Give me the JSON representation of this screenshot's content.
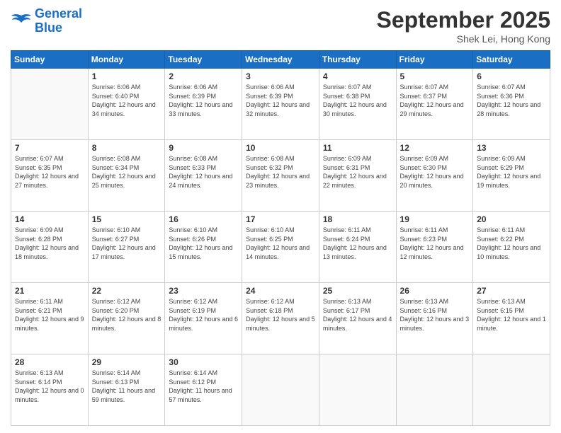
{
  "header": {
    "logo_line1": "General",
    "logo_line2": "Blue",
    "month_title": "September 2025",
    "location": "Shek Lei, Hong Kong"
  },
  "weekdays": [
    "Sunday",
    "Monday",
    "Tuesday",
    "Wednesday",
    "Thursday",
    "Friday",
    "Saturday"
  ],
  "weeks": [
    [
      {
        "day": "",
        "sunrise": "",
        "sunset": "",
        "daylight": ""
      },
      {
        "day": "1",
        "sunrise": "Sunrise: 6:06 AM",
        "sunset": "Sunset: 6:40 PM",
        "daylight": "Daylight: 12 hours and 34 minutes."
      },
      {
        "day": "2",
        "sunrise": "Sunrise: 6:06 AM",
        "sunset": "Sunset: 6:39 PM",
        "daylight": "Daylight: 12 hours and 33 minutes."
      },
      {
        "day": "3",
        "sunrise": "Sunrise: 6:06 AM",
        "sunset": "Sunset: 6:39 PM",
        "daylight": "Daylight: 12 hours and 32 minutes."
      },
      {
        "day": "4",
        "sunrise": "Sunrise: 6:07 AM",
        "sunset": "Sunset: 6:38 PM",
        "daylight": "Daylight: 12 hours and 30 minutes."
      },
      {
        "day": "5",
        "sunrise": "Sunrise: 6:07 AM",
        "sunset": "Sunset: 6:37 PM",
        "daylight": "Daylight: 12 hours and 29 minutes."
      },
      {
        "day": "6",
        "sunrise": "Sunrise: 6:07 AM",
        "sunset": "Sunset: 6:36 PM",
        "daylight": "Daylight: 12 hours and 28 minutes."
      }
    ],
    [
      {
        "day": "7",
        "sunrise": "Sunrise: 6:07 AM",
        "sunset": "Sunset: 6:35 PM",
        "daylight": "Daylight: 12 hours and 27 minutes."
      },
      {
        "day": "8",
        "sunrise": "Sunrise: 6:08 AM",
        "sunset": "Sunset: 6:34 PM",
        "daylight": "Daylight: 12 hours and 25 minutes."
      },
      {
        "day": "9",
        "sunrise": "Sunrise: 6:08 AM",
        "sunset": "Sunset: 6:33 PM",
        "daylight": "Daylight: 12 hours and 24 minutes."
      },
      {
        "day": "10",
        "sunrise": "Sunrise: 6:08 AM",
        "sunset": "Sunset: 6:32 PM",
        "daylight": "Daylight: 12 hours and 23 minutes."
      },
      {
        "day": "11",
        "sunrise": "Sunrise: 6:09 AM",
        "sunset": "Sunset: 6:31 PM",
        "daylight": "Daylight: 12 hours and 22 minutes."
      },
      {
        "day": "12",
        "sunrise": "Sunrise: 6:09 AM",
        "sunset": "Sunset: 6:30 PM",
        "daylight": "Daylight: 12 hours and 20 minutes."
      },
      {
        "day": "13",
        "sunrise": "Sunrise: 6:09 AM",
        "sunset": "Sunset: 6:29 PM",
        "daylight": "Daylight: 12 hours and 19 minutes."
      }
    ],
    [
      {
        "day": "14",
        "sunrise": "Sunrise: 6:09 AM",
        "sunset": "Sunset: 6:28 PM",
        "daylight": "Daylight: 12 hours and 18 minutes."
      },
      {
        "day": "15",
        "sunrise": "Sunrise: 6:10 AM",
        "sunset": "Sunset: 6:27 PM",
        "daylight": "Daylight: 12 hours and 17 minutes."
      },
      {
        "day": "16",
        "sunrise": "Sunrise: 6:10 AM",
        "sunset": "Sunset: 6:26 PM",
        "daylight": "Daylight: 12 hours and 15 minutes."
      },
      {
        "day": "17",
        "sunrise": "Sunrise: 6:10 AM",
        "sunset": "Sunset: 6:25 PM",
        "daylight": "Daylight: 12 hours and 14 minutes."
      },
      {
        "day": "18",
        "sunrise": "Sunrise: 6:11 AM",
        "sunset": "Sunset: 6:24 PM",
        "daylight": "Daylight: 12 hours and 13 minutes."
      },
      {
        "day": "19",
        "sunrise": "Sunrise: 6:11 AM",
        "sunset": "Sunset: 6:23 PM",
        "daylight": "Daylight: 12 hours and 12 minutes."
      },
      {
        "day": "20",
        "sunrise": "Sunrise: 6:11 AM",
        "sunset": "Sunset: 6:22 PM",
        "daylight": "Daylight: 12 hours and 10 minutes."
      }
    ],
    [
      {
        "day": "21",
        "sunrise": "Sunrise: 6:11 AM",
        "sunset": "Sunset: 6:21 PM",
        "daylight": "Daylight: 12 hours and 9 minutes."
      },
      {
        "day": "22",
        "sunrise": "Sunrise: 6:12 AM",
        "sunset": "Sunset: 6:20 PM",
        "daylight": "Daylight: 12 hours and 8 minutes."
      },
      {
        "day": "23",
        "sunrise": "Sunrise: 6:12 AM",
        "sunset": "Sunset: 6:19 PM",
        "daylight": "Daylight: 12 hours and 6 minutes."
      },
      {
        "day": "24",
        "sunrise": "Sunrise: 6:12 AM",
        "sunset": "Sunset: 6:18 PM",
        "daylight": "Daylight: 12 hours and 5 minutes."
      },
      {
        "day": "25",
        "sunrise": "Sunrise: 6:13 AM",
        "sunset": "Sunset: 6:17 PM",
        "daylight": "Daylight: 12 hours and 4 minutes."
      },
      {
        "day": "26",
        "sunrise": "Sunrise: 6:13 AM",
        "sunset": "Sunset: 6:16 PM",
        "daylight": "Daylight: 12 hours and 3 minutes."
      },
      {
        "day": "27",
        "sunrise": "Sunrise: 6:13 AM",
        "sunset": "Sunset: 6:15 PM",
        "daylight": "Daylight: 12 hours and 1 minute."
      }
    ],
    [
      {
        "day": "28",
        "sunrise": "Sunrise: 6:13 AM",
        "sunset": "Sunset: 6:14 PM",
        "daylight": "Daylight: 12 hours and 0 minutes."
      },
      {
        "day": "29",
        "sunrise": "Sunrise: 6:14 AM",
        "sunset": "Sunset: 6:13 PM",
        "daylight": "Daylight: 11 hours and 59 minutes."
      },
      {
        "day": "30",
        "sunrise": "Sunrise: 6:14 AM",
        "sunset": "Sunset: 6:12 PM",
        "daylight": "Daylight: 11 hours and 57 minutes."
      },
      {
        "day": "",
        "sunrise": "",
        "sunset": "",
        "daylight": ""
      },
      {
        "day": "",
        "sunrise": "",
        "sunset": "",
        "daylight": ""
      },
      {
        "day": "",
        "sunrise": "",
        "sunset": "",
        "daylight": ""
      },
      {
        "day": "",
        "sunrise": "",
        "sunset": "",
        "daylight": ""
      }
    ]
  ]
}
